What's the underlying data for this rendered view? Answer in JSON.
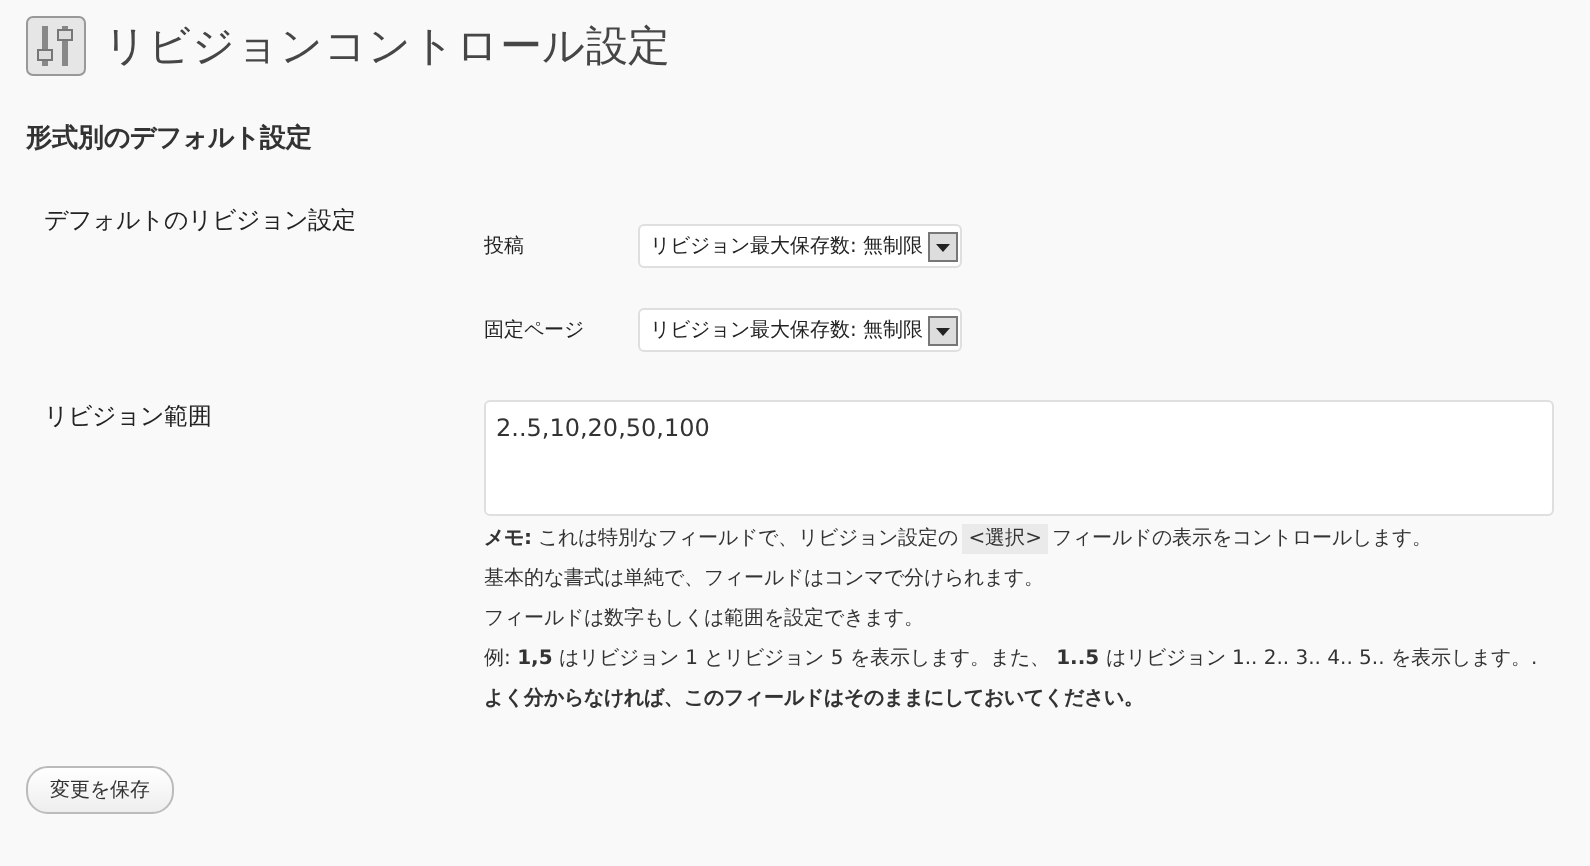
{
  "title": "リビジョンコントロール設定",
  "section_heading": "形式別のデフォルト設定",
  "default_setting": {
    "label": "デフォルトのリビジョン設定",
    "selects": [
      {
        "label": "投稿",
        "value": "リビジョン最大保存数: 無制限"
      },
      {
        "label": "固定ページ",
        "value": "リビジョン最大保存数: 無制限"
      }
    ]
  },
  "range": {
    "label": "リビジョン範囲",
    "value": "2..5,10,20,50,100"
  },
  "notes": [
    {
      "kind": "code",
      "before": "**メモ:** これは特別なフィールドで、リビジョン設定の",
      "code": "<選択>",
      "after": "フィールドの表示をコントロールします。"
    },
    {
      "kind": "plain",
      "text": "基本的な書式は単純で、フィールドはコンマで分けられます。"
    },
    {
      "kind": "plain",
      "text": "フィールドは数字もしくは範囲を設定できます。"
    },
    {
      "kind": "plain",
      "text": "例: **1,5** はリビジョン 1 とリビジョン 5 を表示します。また、 **1..5** はリビジョン 1.. 2.. 3.. 4.. 5.. を表示します。."
    },
    {
      "kind": "strong",
      "text": "よく分からなければ、このフィールドはそのままにしておいてください。"
    }
  ],
  "save_button": "変更を保存"
}
